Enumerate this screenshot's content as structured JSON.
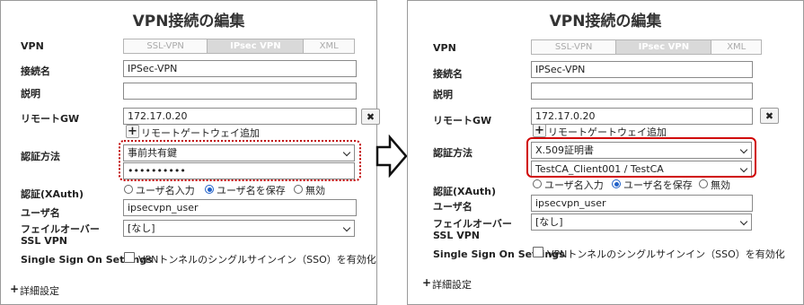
{
  "left": {
    "title": "VPN接続の編集",
    "vpn_label": "VPN",
    "vpn_modes": [
      "SSL-VPN",
      "IPsec VPN",
      "XML"
    ],
    "vpn_active": "IPsec VPN",
    "name_label": "接続名",
    "name_value": "IPSec-VPN",
    "desc_label": "説明",
    "desc_value": "",
    "gw_label": "リモートGW",
    "gw_value": "172.17.0.20",
    "gw_remove": "✖",
    "gw_add_icon": "+",
    "gw_add_label": "リモートゲートウェイ追加",
    "auth_label": "認証方法",
    "auth_value": "事前共有鍵",
    "psk_value": "••••••••••",
    "xauth_label": "認証(XAuth)",
    "xauth_options": [
      "ユーザ名入力",
      "ユーザ名を保存",
      "無効"
    ],
    "xauth_selected": "ユーザ名を保存",
    "user_label": "ユーザ名",
    "user_value": "ipsecvpn_user",
    "failover_label": "フェイルオーバーSSL VPN",
    "failover_value": "[なし]",
    "sso_label": "Single Sign On Settings",
    "sso_checkbox_label": "VPNトンネルのシングルサインイン（SSO）を有効化",
    "advanced_label": "詳細設定",
    "advanced_icon": "+"
  },
  "right": {
    "title": "VPN接続の編集",
    "vpn_label": "VPN",
    "vpn_modes": [
      "SSL-VPN",
      "IPsec VPN",
      "XML"
    ],
    "vpn_active": "IPsec VPN",
    "name_label": "接続名",
    "name_value": "IPSec-VPN",
    "desc_label": "説明",
    "desc_value": "",
    "gw_label": "リモートGW",
    "gw_value": "172.17.0.20",
    "gw_remove": "✖",
    "gw_add_icon": "+",
    "gw_add_label": "リモートゲートウェイ追加",
    "auth_label": "認証方法",
    "auth_value": "X.509証明書",
    "cert_value": "TestCA_Client001 / TestCA",
    "xauth_label": "認証(XAuth)",
    "xauth_options": [
      "ユーザ名入力",
      "ユーザ名を保存",
      "無効"
    ],
    "xauth_selected": "ユーザ名を保存",
    "user_label": "ユーザ名",
    "user_value": "ipsecvpn_user",
    "failover_label": "フェイルオーバーSSL VPN",
    "failover_value": "[なし]",
    "sso_label": "Single Sign On Settings",
    "sso_checkbox_label": "VPNトンネルのシングルサインイン（SSO）を有効化",
    "advanced_label": "詳細設定",
    "advanced_icon": "+"
  },
  "colors": {
    "highlight": "#d00000",
    "radio_accent": "#2060c8"
  },
  "icons": {
    "transition_arrow": "right-arrow-icon"
  }
}
